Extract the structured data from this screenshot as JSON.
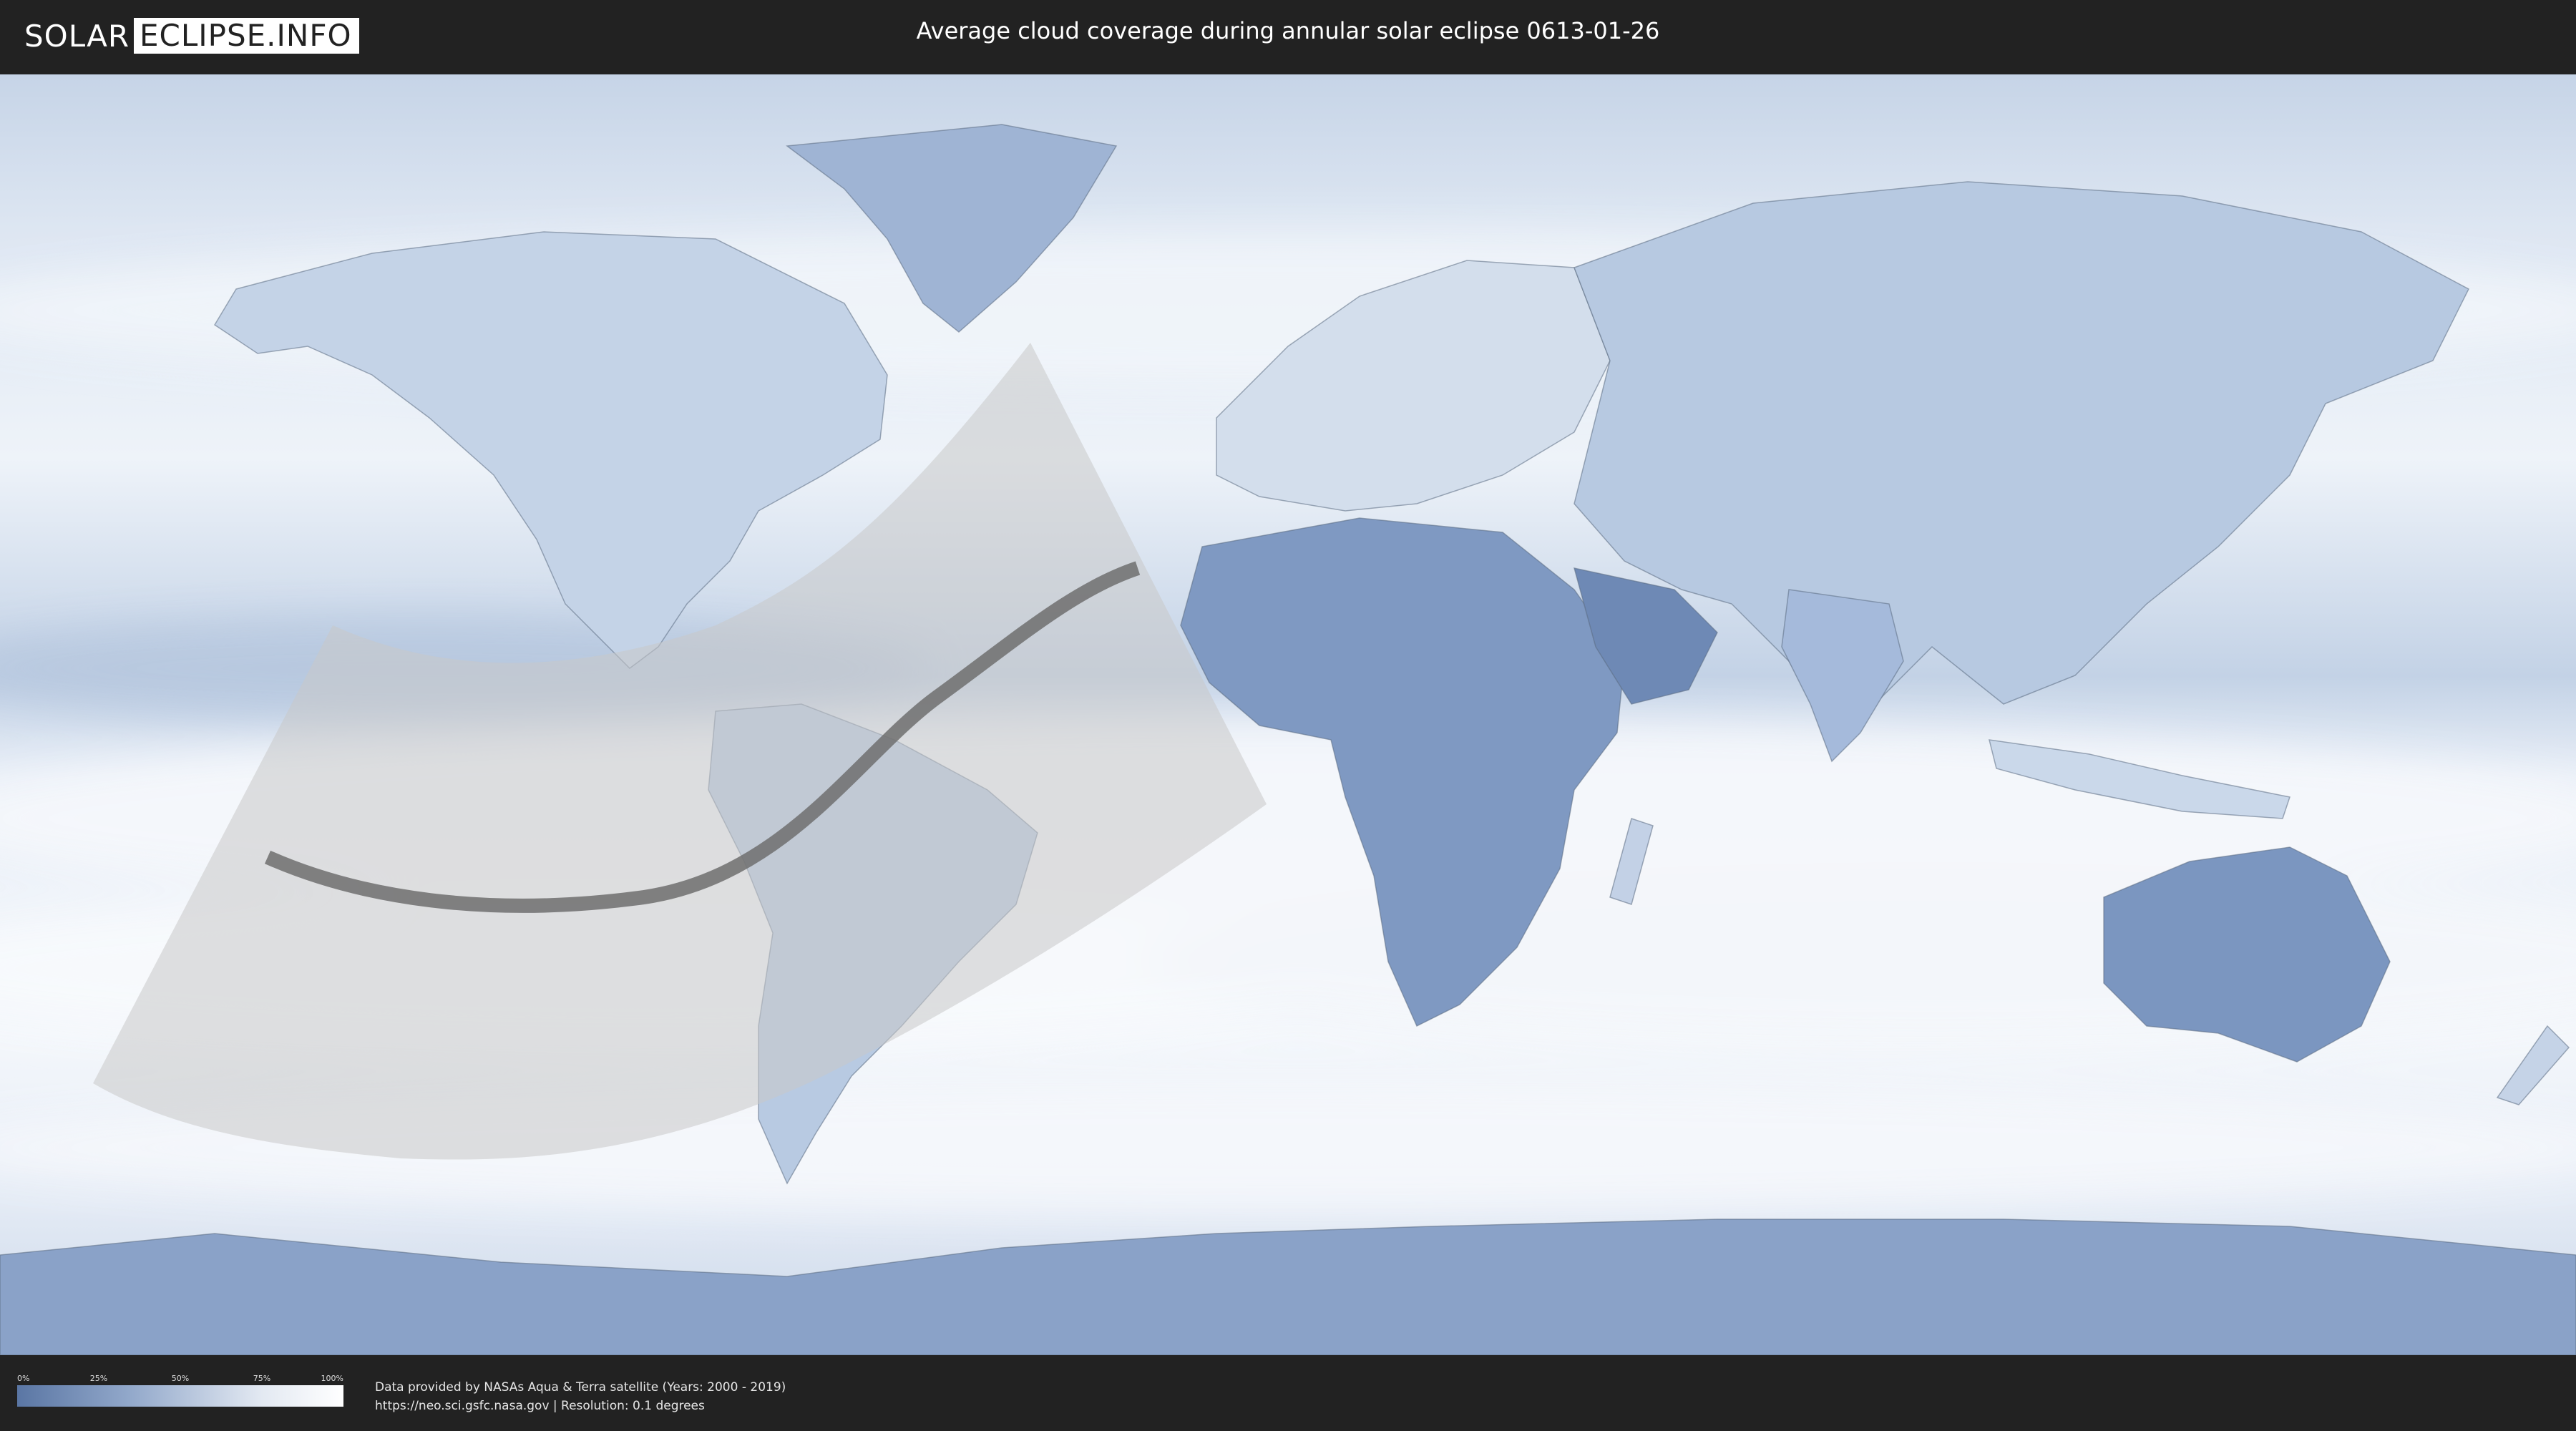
{
  "header": {
    "logo_left": "SOLAR",
    "logo_right": "ECLIPSE.INFO",
    "title": "Average cloud coverage during annular solar eclipse 0613-01-26"
  },
  "legend": {
    "ticks": [
      "0%",
      "25%",
      "50%",
      "75%",
      "100%"
    ],
    "colors": {
      "low": "#5a76a4",
      "mid": "#93a9cb",
      "high": "#ffffff"
    }
  },
  "footer": {
    "line1": "Data provided by NASAs Aqua & Terra satellite (Years: 2000 - 2019)",
    "line2": "https://neo.sci.gsfc.nasa.gov | Resolution: 0.1 degrees"
  },
  "map": {
    "colors": {
      "ocean_clear": "#a9bdd8",
      "cloud": "#eef2f8",
      "land_clear": "#7f99c2",
      "eclipse_zone": "#c9c9c9",
      "central_path": "#6f6f6f",
      "borders": "#5b6b82"
    }
  }
}
